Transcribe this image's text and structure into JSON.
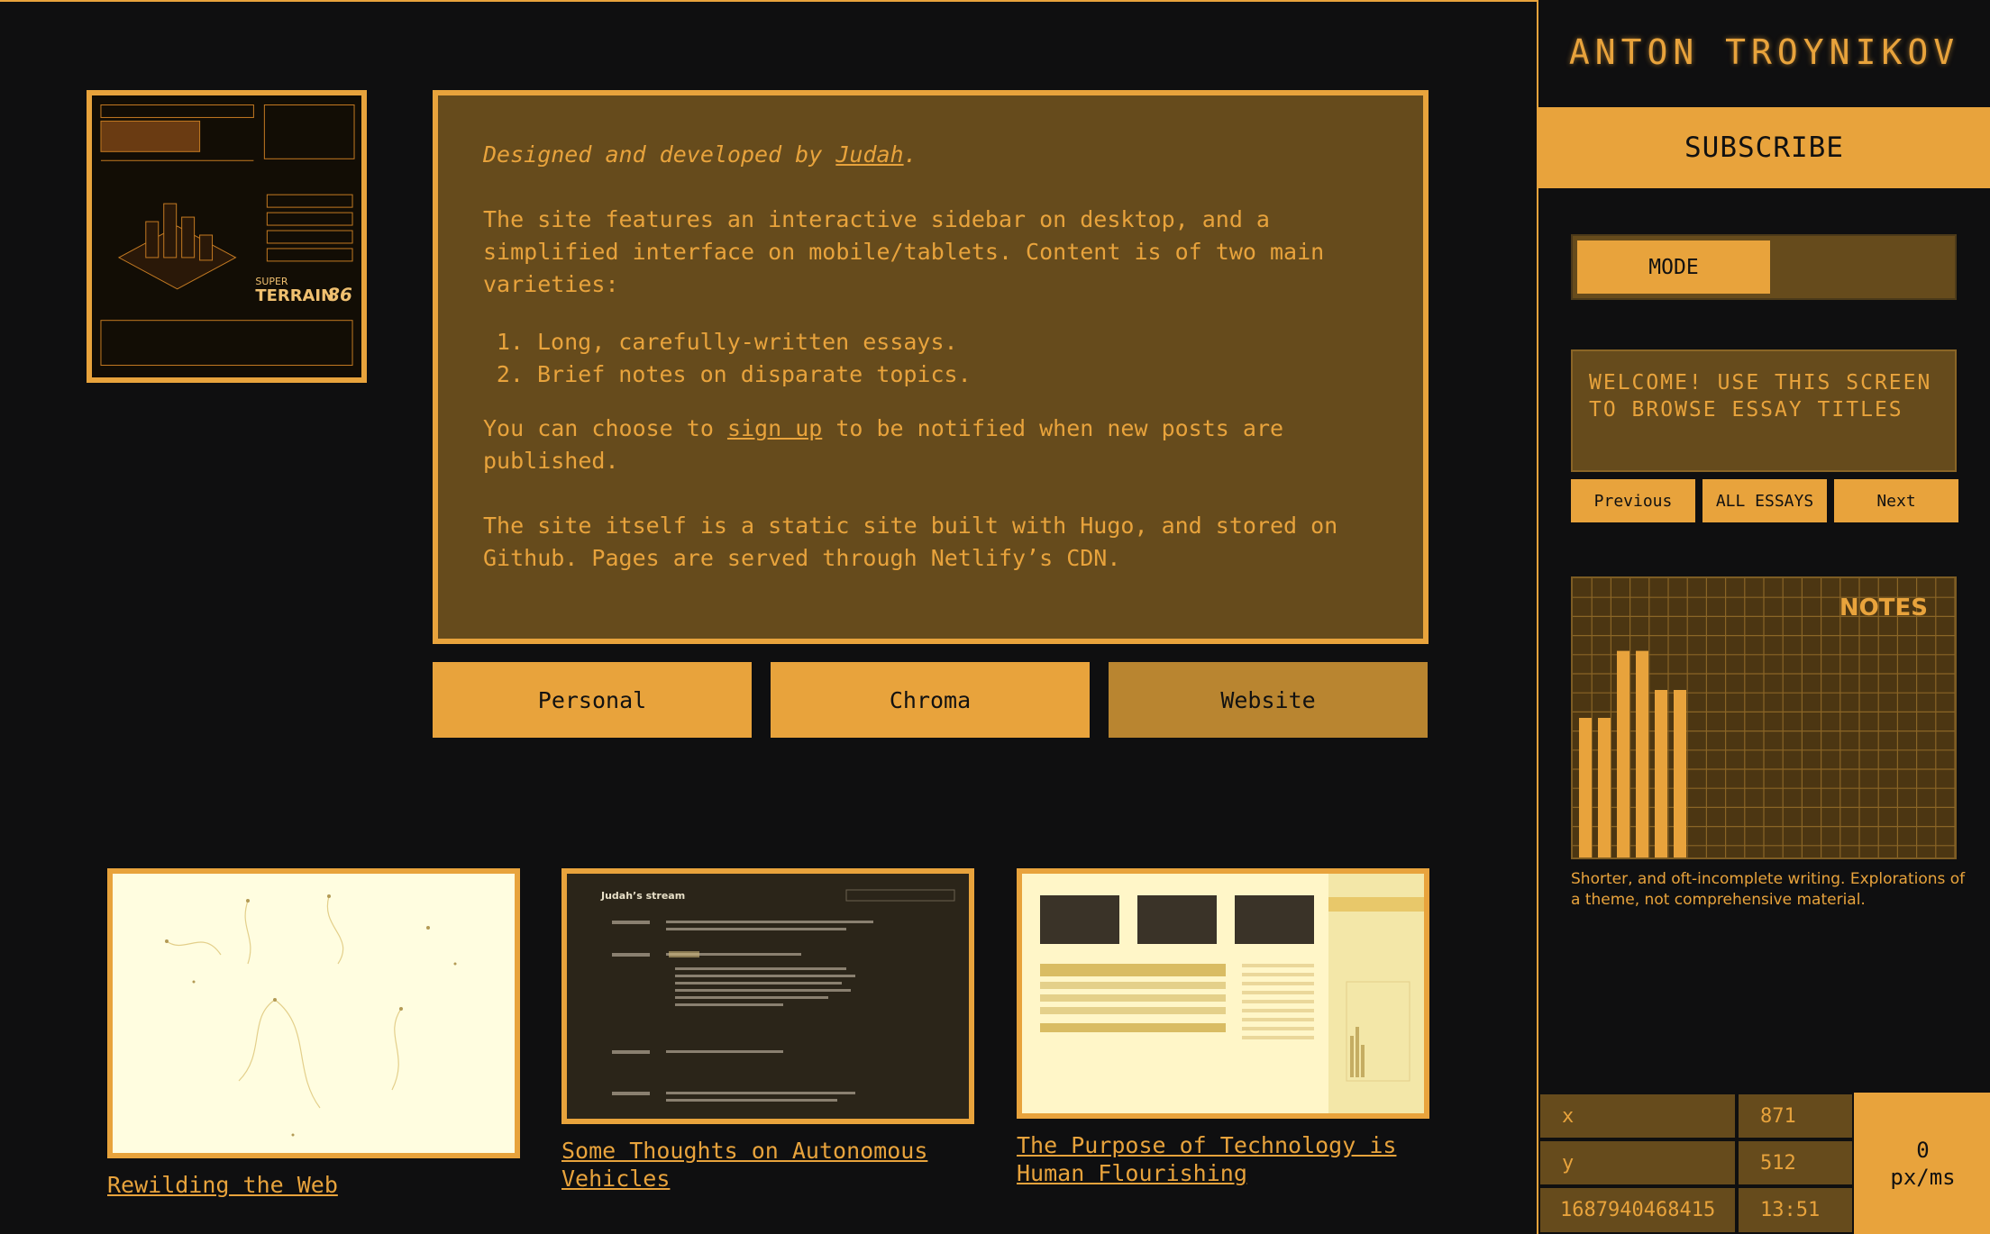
{
  "info": {
    "credit_prefix": "Designed and developed by ",
    "credit_link": "Judah",
    "credit_suffix": ".",
    "para1": "The site features an interactive sidebar on desktop, and a simplified interface on mobile/tablets. Content is of two main varieties:",
    "list": [
      "Long, carefully-written essays.",
      "Brief notes on disparate topics."
    ],
    "para2_prefix": "You can choose to ",
    "para2_link": "sign up",
    "para2_suffix": " to be notified when new posts are published.",
    "para3": "The site itself is a static site built with Hugo, and stored on Github. Pages are served through Netlify’s CDN."
  },
  "hero": {
    "brand_top": "SUPER",
    "brand_main": "TERRAIN",
    "brand_num": "86"
  },
  "categories": [
    {
      "label": "Personal",
      "active": false
    },
    {
      "label": "Chroma",
      "active": false
    },
    {
      "label": "Website",
      "active": true
    }
  ],
  "cards": [
    {
      "title": "Rewilding the Web"
    },
    {
      "title": "Some Thoughts on Autonomous Vehicles",
      "thumb_heading": "Judah’s stream"
    },
    {
      "title": "The Purpose of Technology is Human Flourishing"
    }
  ],
  "sidebar": {
    "author": "ANTON TROYNIKOV",
    "subscribe": "SUBSCRIBE",
    "mode": "MODE",
    "welcome": "WELCOME! USE THIS SCREEN TO BROWSE ESSAY TITLES",
    "prev": "Previous",
    "all": "ALL ESSAYS",
    "next": "Next",
    "notes_title": "NOTES",
    "notes_desc": "Shorter, and oft-incomplete writing. Explorations of a theme, not comprehensive material."
  },
  "notes_bars": [
    0.5,
    0.5,
    0.74,
    0.74,
    0.6,
    0.6
  ],
  "readout": {
    "x_label": "x",
    "x_value": "871",
    "y_label": "y",
    "y_value": "512",
    "timestamp": "1687940468415",
    "clock": "13:51",
    "speed_value": "0",
    "speed_unit": "px/ms"
  },
  "colors": {
    "accent": "#e8a33c",
    "panel": "#664b1c",
    "background": "#0f0f10",
    "active": "#b98530"
  }
}
